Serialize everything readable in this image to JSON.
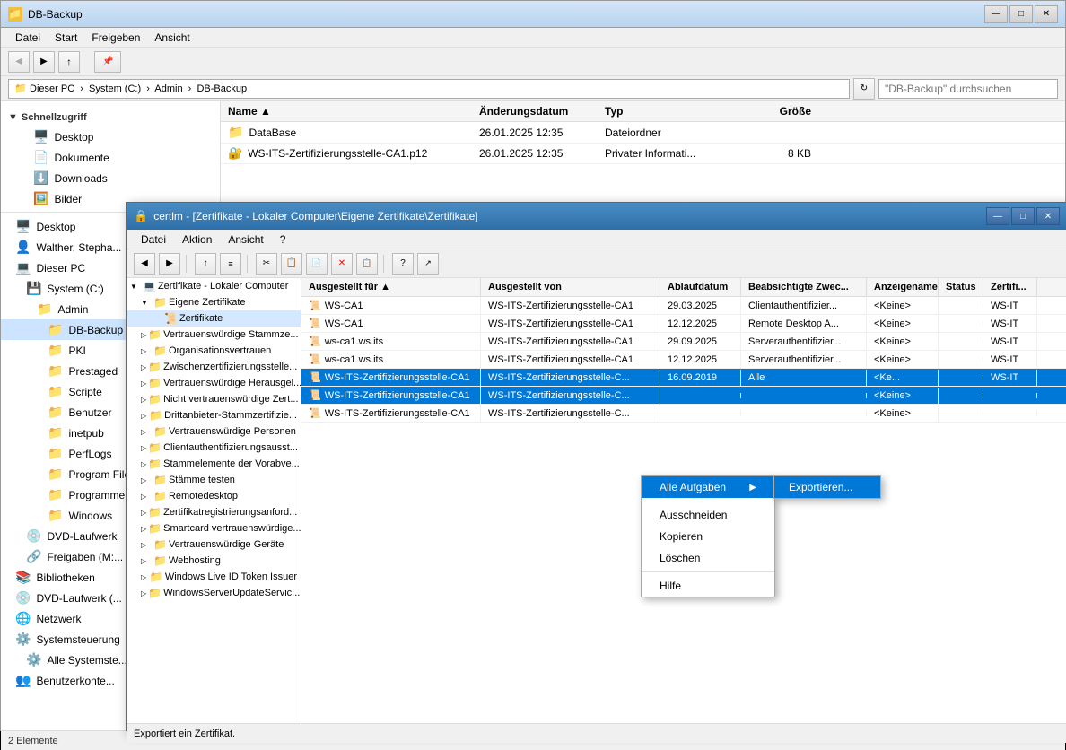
{
  "explorer": {
    "title": "DB-Backup",
    "menuItems": [
      "Datei",
      "Start",
      "Freigeben",
      "Ansicht"
    ],
    "addressBar": "Dieser PC  ›  System (C:)  ›  Admin  ›  DB-Backup",
    "searchPlaceholder": "\"DB-Backup\" durchsuchen",
    "columns": [
      "Name",
      "Änderungsdatum",
      "Typ",
      "Größe"
    ],
    "files": [
      {
        "name": "DataBase",
        "date": "26.01.2025 12:35",
        "type": "Dateiordner",
        "size": "",
        "icon": "folder"
      },
      {
        "name": "WS-ITS-Zertifizierungsstelle-CA1.p12",
        "date": "26.01.2025 12:35",
        "type": "Privater Informati...",
        "size": "8 KB",
        "icon": "cert"
      }
    ],
    "sidebar": {
      "quickAccess": "Schnellzugriff",
      "items": [
        {
          "label": "Desktop",
          "indent": 1
        },
        {
          "label": "Dokumente",
          "indent": 1
        },
        {
          "label": "Downloads",
          "indent": 1
        },
        {
          "label": "Bilder",
          "indent": 1
        },
        {
          "label": "Desktop",
          "indent": 0
        },
        {
          "label": "Walther, Stepha...",
          "indent": 0
        },
        {
          "label": "Dieser PC",
          "indent": 0
        },
        {
          "label": "System (C:)",
          "indent": 1
        },
        {
          "label": "Admin",
          "indent": 2
        },
        {
          "label": "DB-Backup",
          "indent": 3,
          "selected": true
        },
        {
          "label": "PKI",
          "indent": 3
        },
        {
          "label": "Prestaged",
          "indent": 3
        },
        {
          "label": "Scripte",
          "indent": 3
        },
        {
          "label": "Benutzer",
          "indent": 3
        },
        {
          "label": "inetpub",
          "indent": 3
        },
        {
          "label": "PerfLogs",
          "indent": 3
        },
        {
          "label": "Program File...",
          "indent": 3
        },
        {
          "label": "Programme",
          "indent": 3
        },
        {
          "label": "Windows",
          "indent": 3
        },
        {
          "label": "DVD-Laufwerk",
          "indent": 1
        },
        {
          "label": "Freigaben (M:...",
          "indent": 1
        },
        {
          "label": "Bibliotheken",
          "indent": 0
        },
        {
          "label": "DVD-Laufwerk (...",
          "indent": 0
        },
        {
          "label": "Netzwerk",
          "indent": 0
        },
        {
          "label": "Systemsteuerung",
          "indent": 0
        },
        {
          "label": "Alle Systemste...",
          "indent": 1
        },
        {
          "label": "Benutzerkonte...",
          "indent": 0
        }
      ]
    },
    "statusBar": "2 Elemente"
  },
  "certlm": {
    "title": "certlm - [Zertifikate - Lokaler Computer\\Eigene Zertifikate\\Zertifikate]",
    "menuItems": [
      "Datei",
      "Aktion",
      "Ansicht",
      "?"
    ],
    "treeItems": [
      {
        "label": "Zertifikate - Lokaler Computer",
        "level": 0
      },
      {
        "label": "Eigene Zertifikate",
        "level": 1
      },
      {
        "label": "Zertifikate",
        "level": 2,
        "selected": true
      },
      {
        "label": "Vertrauenswürdige Stammze...",
        "level": 1
      },
      {
        "label": "Organisationsvertrauen",
        "level": 1
      },
      {
        "label": "Zwischenzertifizierungsstelle...",
        "level": 1
      },
      {
        "label": "Vertrauenswürdige Herausgel...",
        "level": 1
      },
      {
        "label": "Nicht vertrauenswürdige Zert...",
        "level": 1
      },
      {
        "label": "Drittanbieter-Stammzertifizie...",
        "level": 1
      },
      {
        "label": "Vertrauenswürdige Personen",
        "level": 1
      },
      {
        "label": "Clientauthentifizierungsausst...",
        "level": 1
      },
      {
        "label": "Stammelemente der Vorabve...",
        "level": 1
      },
      {
        "label": "Stämme testen",
        "level": 1
      },
      {
        "label": "Remotedesktop",
        "level": 1
      },
      {
        "label": "Zertifikatregistrierungsanford...",
        "level": 1
      },
      {
        "label": "Smartcard vertrauenswürdige...",
        "level": 1
      },
      {
        "label": "Vertrauenswürdige Geräte",
        "level": 1
      },
      {
        "label": "Webhosting",
        "level": 1
      },
      {
        "label": "Windows Live ID Token Issuer",
        "level": 1
      },
      {
        "label": "WindowsServerUpdateServic...",
        "level": 1
      }
    ],
    "certColumns": [
      "Ausgestellt für",
      "Ausgestellt von",
      "Ablaufdatum",
      "Beabsichtigte Zwec...",
      "Anzeigename",
      "Status",
      "Zertifi..."
    ],
    "certs": [
      {
        "issuedFor": "WS-CA1",
        "issuedBy": "WS-ITS-Zertifizierungsstelle-CA1",
        "expiry": "29.03.2025",
        "purpose": "Clientauthentifizier...",
        "displayName": "<Keine>",
        "status": "",
        "cert": "WS-IT"
      },
      {
        "issuedFor": "WS-CA1",
        "issuedBy": "WS-ITS-Zertifizierungsstelle-CA1",
        "expiry": "12.12.2025",
        "purpose": "Remote Desktop A...",
        "displayName": "<Keine>",
        "status": "",
        "cert": "WS-IT"
      },
      {
        "issuedFor": "ws-ca1.ws.its",
        "issuedBy": "WS-ITS-Zertifizierungsstelle-CA1",
        "expiry": "29.09.2025",
        "purpose": "Serverauthentifizier...",
        "displayName": "<Keine>",
        "status": "",
        "cert": "WS-IT"
      },
      {
        "issuedFor": "ws-ca1.ws.its",
        "issuedBy": "WS-ITS-Zertifizierungsstelle-CA1",
        "expiry": "12.12.2025",
        "purpose": "Serverauthentifizier...",
        "displayName": "<Keine>",
        "status": "",
        "cert": "WS-IT"
      },
      {
        "issuedFor": "WS-ITS-Zertifizierungsstelle-CA1",
        "issuedBy": "WS-ITS-Zertifizierungsstelle-C...",
        "expiry": "16.09.2019",
        "purpose": "Alle",
        "displayName": "<Ke...",
        "status": "",
        "cert": "WS-IT",
        "selected": true
      },
      {
        "issuedFor": "WS-ITS-Zertifizierungsstelle-CA1",
        "issuedBy": "WS-ITS-Zertifizierungsstelle-C...",
        "expiry": "",
        "purpose": "",
        "displayName": "<Keine>",
        "status": "",
        "cert": "",
        "selected": true
      },
      {
        "issuedFor": "WS-ITS-Zertifizierungsstelle-CA1",
        "issuedBy": "WS-ITS-Zertifizierungsstelle-C...",
        "expiry": "",
        "purpose": "",
        "displayName": "<Keine>",
        "status": "",
        "cert": ""
      }
    ],
    "statusBar": "Exportiert ein Zertifikat."
  },
  "contextMenu": {
    "items": [
      {
        "label": "Alle Aufgaben",
        "hasSubmenu": true,
        "active": true
      },
      {
        "label": "Ausschneiden"
      },
      {
        "label": "Kopieren"
      },
      {
        "label": "Löschen"
      },
      {
        "label": "Hilfe"
      }
    ],
    "submenuItems": [
      {
        "label": "Exportieren...",
        "active": true
      }
    ]
  },
  "icons": {
    "folder": "📁",
    "cert": "🔐",
    "file": "📄",
    "back": "◀",
    "forward": "▶",
    "up": "↑",
    "arrow_right": "▶",
    "arrow_down": "▼",
    "minimize": "—",
    "maximize": "□",
    "close": "✕",
    "expand": "▷",
    "collapse": "▽"
  }
}
